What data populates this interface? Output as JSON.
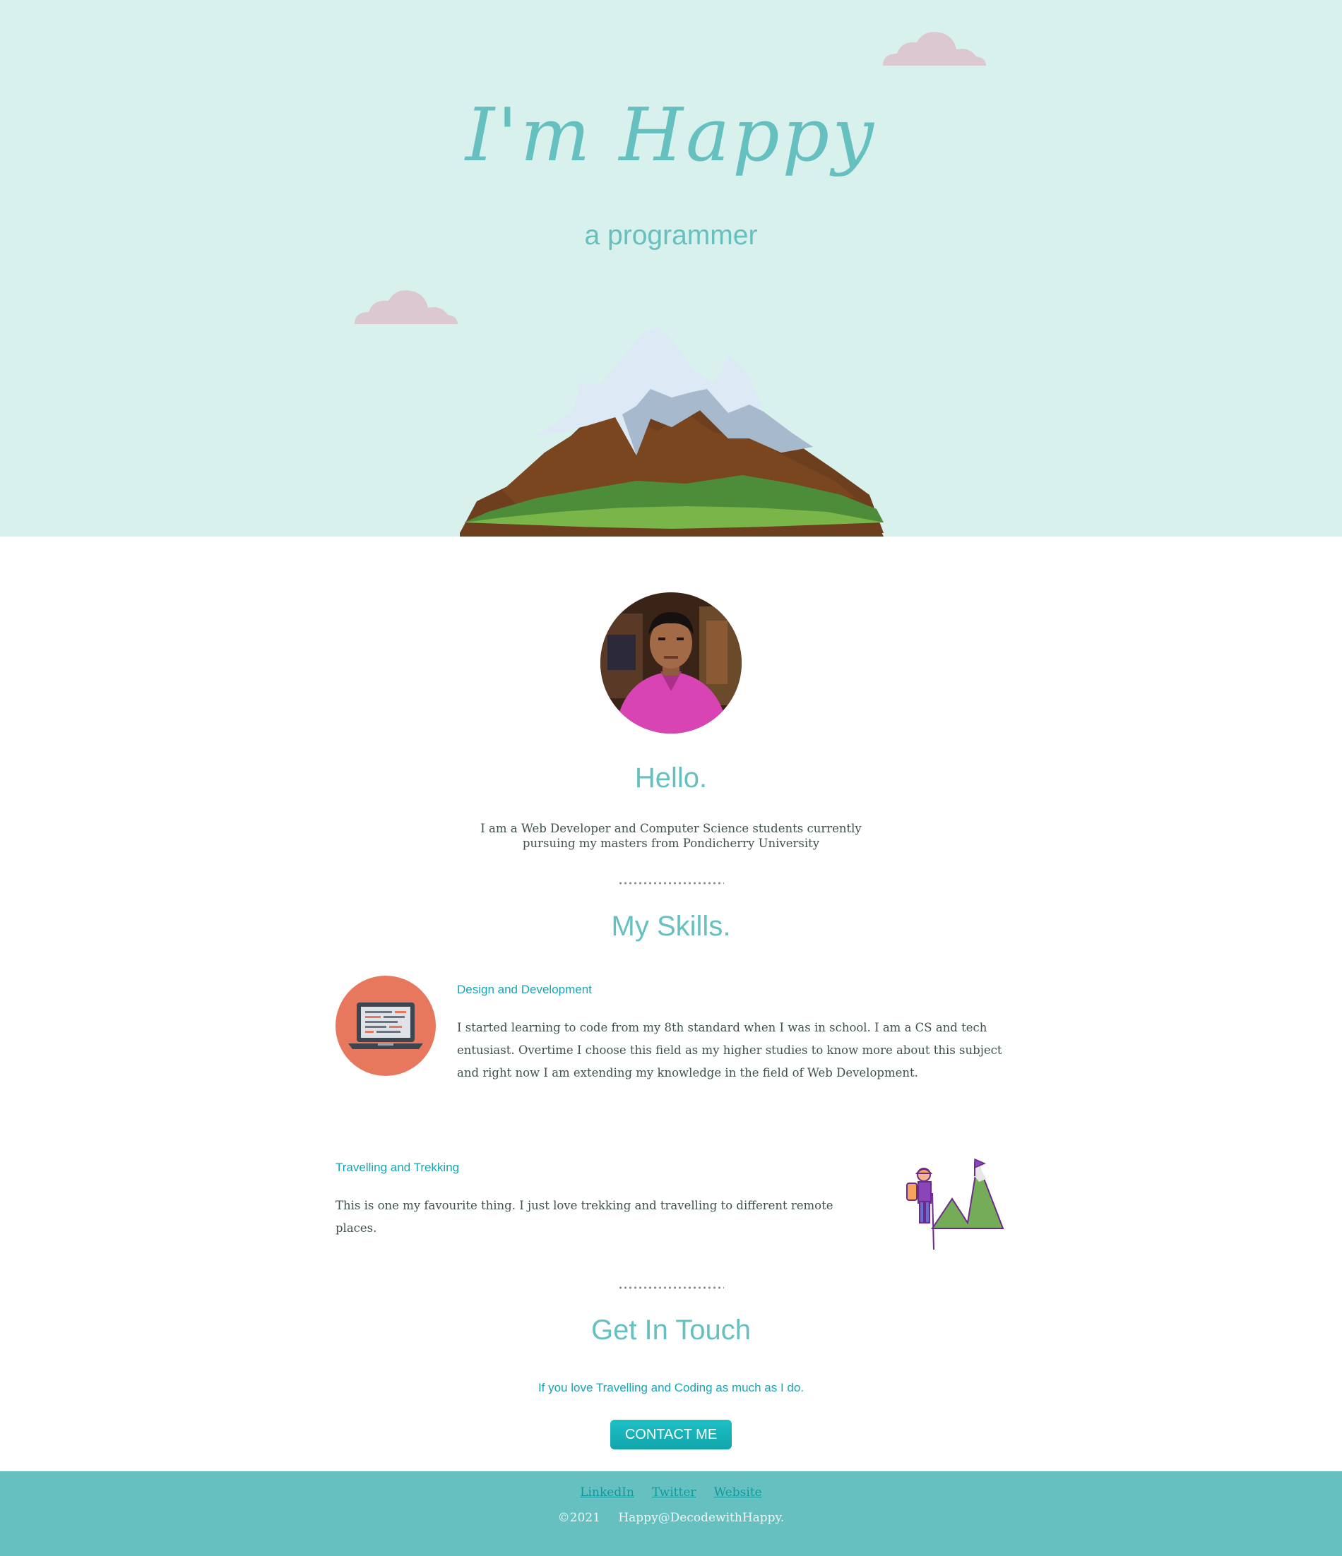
{
  "header": {
    "title": "I'm Happy",
    "subtitle": "a programmer"
  },
  "about": {
    "heading": "Hello.",
    "intro": "I am a Web Developer and Computer Science students currently pursuing my masters from Pondicherry University"
  },
  "skills": {
    "heading": "My Skills.",
    "items": [
      {
        "title": "Design and Development",
        "text": "I started learning to code from my 8th standard when I was in school. I am a CS and tech entusiast. Overtime I choose this field as my higher studies to know more about this subject and right now I am extending my knowledge in the field of Web Development.",
        "icon": "laptop-icon"
      },
      {
        "title": "Travelling and Trekking",
        "text": "This is one my favourite thing. I just love trekking and travelling to different remote places.",
        "icon": "hiker-mountain-icon"
      }
    ]
  },
  "contact": {
    "heading": "Get In Touch",
    "subtext": "If you love Travelling and Coding as much as I do.",
    "button_label": "CONTACT ME"
  },
  "footer": {
    "links": [
      "LinkedIn",
      "Twitter",
      "Website"
    ],
    "copyright": "©2021",
    "owner": "Happy@DecodewithHappy."
  },
  "colors": {
    "top_background": "#d9f1ed",
    "accent": "#66c0bf",
    "link": "#11999e",
    "footer": "#66c0bf",
    "text": "#40514e",
    "cloud": "#dbc8d0"
  }
}
